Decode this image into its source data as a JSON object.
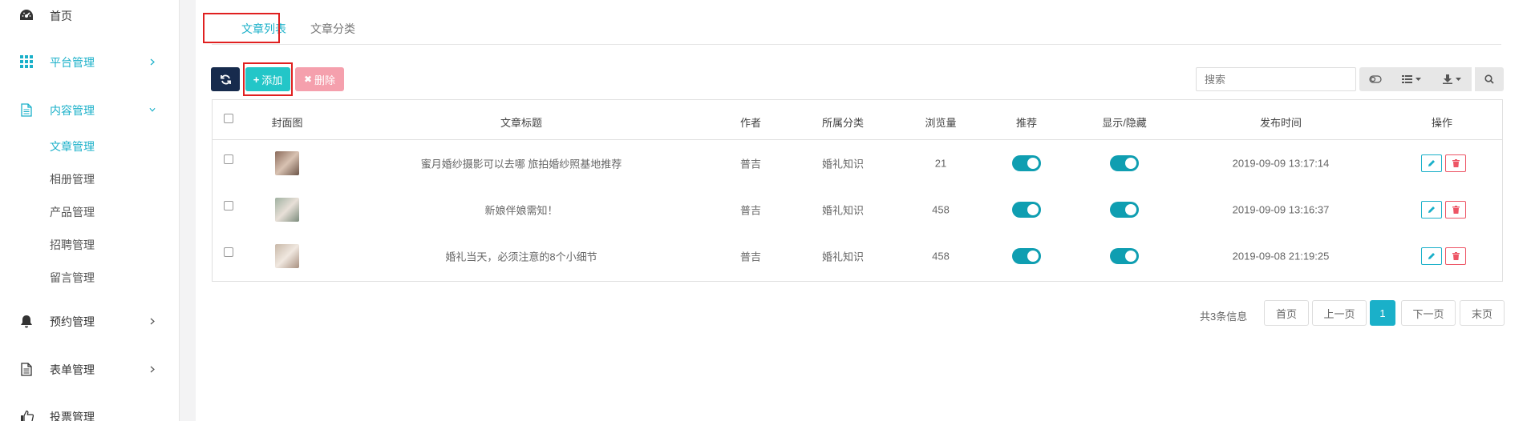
{
  "colors": {
    "accent": "#1ab0c9",
    "dark": "#172b4d",
    "add": "#23c6c8",
    "delete": "#f5a0ad",
    "switch_on": "#0f9eb1",
    "edit": "#1ab0c9",
    "remove": "#ed5565"
  },
  "sidebar": {
    "items": [
      {
        "label": "首页",
        "icon": "dashboard-icon"
      },
      {
        "label": "平台管理",
        "icon": "grid-icon"
      },
      {
        "label": "内容管理",
        "icon": "document-icon"
      },
      {
        "label": "预约管理",
        "icon": "bell-icon"
      },
      {
        "label": "表单管理",
        "icon": "form-icon"
      },
      {
        "label": "投票管理",
        "icon": "thumbs-up-icon"
      }
    ],
    "subitems": [
      "文章管理",
      "相册管理",
      "产品管理",
      "招聘管理",
      "留言管理"
    ]
  },
  "tabs": [
    "文章列表",
    "文章分类"
  ],
  "toolbar": {
    "add_label": "添加",
    "delete_label": "删除",
    "search_placeholder": "搜索"
  },
  "table": {
    "headers": [
      "封面图",
      "文章标题",
      "作者",
      "所属分类",
      "浏览量",
      "推荐",
      "显示/隐藏",
      "发布时间",
      "操作"
    ],
    "rows": [
      {
        "title": "蜜月婚纱摄影可以去哪 旅拍婚纱照基地推荐",
        "author": "普吉",
        "category": "婚礼知识",
        "views": "21",
        "recommend": true,
        "visible": true,
        "date": "2019-09-09 13:17:14"
      },
      {
        "title": "新娘伴娘需知！",
        "author": "普吉",
        "category": "婚礼知识",
        "views": "458",
        "recommend": true,
        "visible": true,
        "date": "2019-09-09 13:16:37"
      },
      {
        "title": "婚礼当天，必须注意的8个小细节",
        "author": "普吉",
        "category": "婚礼知识",
        "views": "458",
        "recommend": true,
        "visible": true,
        "date": "2019-09-08 21:19:25"
      }
    ]
  },
  "pagination": {
    "info": "共3条信息",
    "first": "首页",
    "prev": "上一页",
    "current": "1",
    "next": "下一页",
    "last": "末页"
  }
}
